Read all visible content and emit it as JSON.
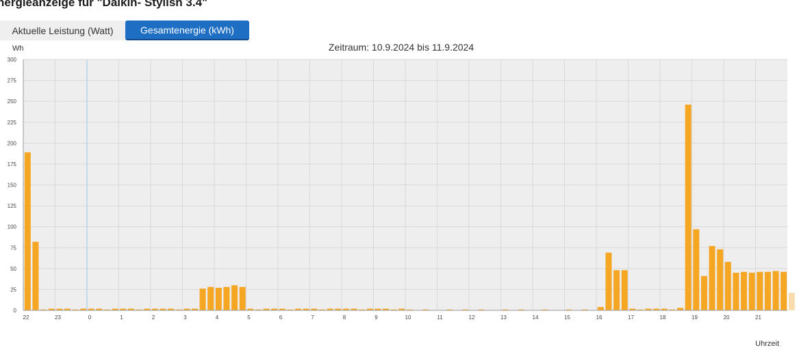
{
  "page": {
    "title": "nergieanzeige für \"Daikin- Stylish 3.4\""
  },
  "tabs": [
    {
      "label": "Aktuelle Leistung (Watt)",
      "active": false
    },
    {
      "label": "Gesamtenergie (kWh)",
      "active": true
    }
  ],
  "colors": {
    "bar": "#f5a623",
    "bar_partial": "#f8dcae",
    "plot_bg": "#eeeeee",
    "grid": "#d8d8d8",
    "marker_line": "#b9d1ea",
    "tab_active": "#1e6fc4"
  },
  "chart_data": {
    "type": "bar",
    "title": "Zeitraum: 10.9.2024 bis 11.9.2024",
    "ylabel": "Wh",
    "xlabel": "Uhrzeit",
    "ylim": [
      0,
      300
    ],
    "yticks": [
      0,
      25,
      50,
      75,
      100,
      125,
      150,
      175,
      200,
      225,
      250,
      275,
      300
    ],
    "grid": true,
    "x_ticks": [
      {
        "label": "22",
        "index": 0
      },
      {
        "label": "23",
        "index": 4
      },
      {
        "label": "0",
        "index": 8
      },
      {
        "label": "1",
        "index": 12
      },
      {
        "label": "2",
        "index": 16
      },
      {
        "label": "3",
        "index": 20
      },
      {
        "label": "4",
        "index": 24
      },
      {
        "label": "5",
        "index": 28
      },
      {
        "label": "6",
        "index": 32
      },
      {
        "label": "7",
        "index": 36
      },
      {
        "label": "8",
        "index": 40
      },
      {
        "label": "9",
        "index": 44
      },
      {
        "label": "10",
        "index": 48
      },
      {
        "label": "11",
        "index": 52
      },
      {
        "label": "12",
        "index": 56
      },
      {
        "label": "13",
        "index": 60
      },
      {
        "label": "14",
        "index": 64
      },
      {
        "label": "15",
        "index": 68
      },
      {
        "label": "16",
        "index": 72
      },
      {
        "label": "17",
        "index": 76
      },
      {
        "label": "18",
        "index": 80
      },
      {
        "label": "19",
        "index": 84
      },
      {
        "label": "20",
        "index": 88
      },
      {
        "label": "21",
        "index": 92
      }
    ],
    "values": [
      189,
      82,
      1,
      2,
      2,
      2,
      1,
      2,
      2,
      2,
      1,
      2,
      2,
      2,
      1,
      2,
      2,
      2,
      2,
      1,
      2,
      2,
      26,
      28,
      27,
      28,
      30,
      28,
      2,
      1,
      2,
      2,
      2,
      1,
      2,
      2,
      2,
      1,
      2,
      2,
      2,
      2,
      1,
      2,
      2,
      2,
      1,
      2,
      1,
      0,
      1,
      0,
      0,
      1,
      0,
      1,
      0,
      1,
      0,
      0,
      1,
      0,
      1,
      0,
      0,
      1,
      0,
      0,
      1,
      0,
      1,
      0,
      4,
      69,
      48,
      48,
      2,
      1,
      2,
      2,
      2,
      1,
      3,
      246,
      97,
      41,
      77,
      73,
      58,
      45,
      46,
      45,
      46,
      46,
      47,
      46,
      21
    ],
    "partial_last": true
  }
}
